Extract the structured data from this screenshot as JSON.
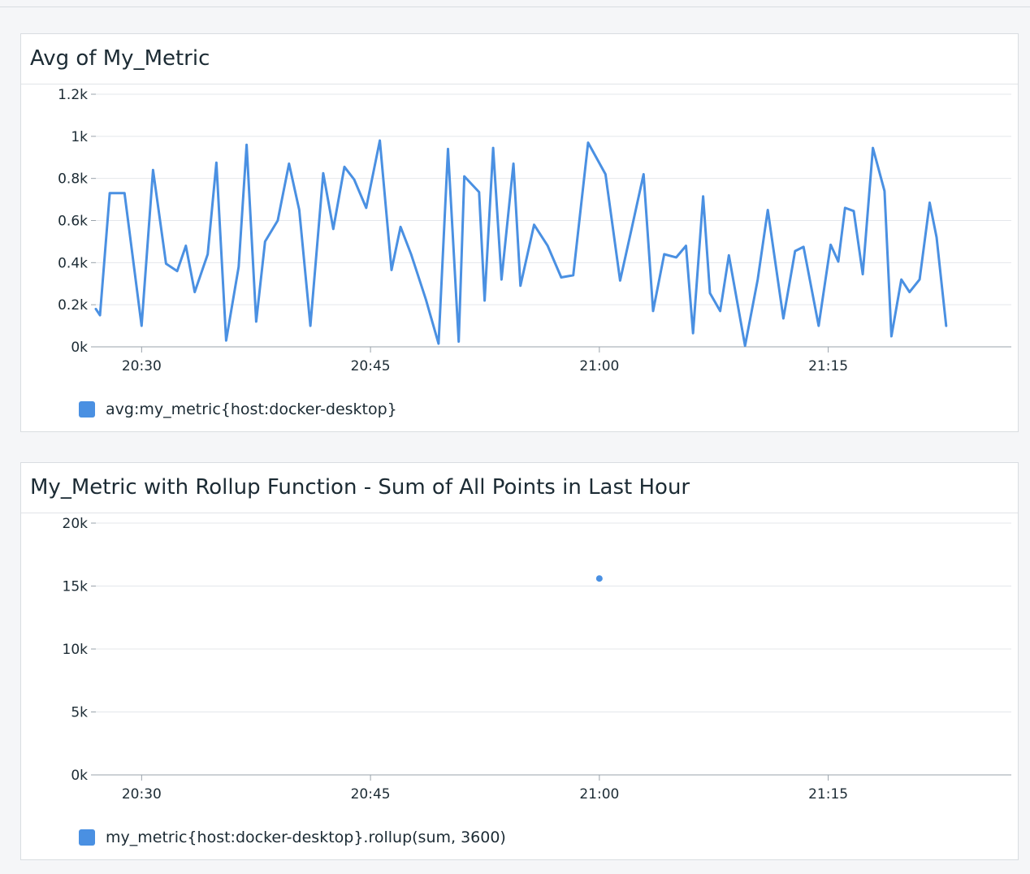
{
  "panels": [
    {
      "title": "Avg of My_Metric",
      "legend": "avg:my_metric{host:docker-desktop}",
      "color": "#4a90e2"
    },
    {
      "title": "My_Metric with Rollup Function - Sum of All Points in Last Hour",
      "legend": "my_metric{host:docker-desktop}.rollup(sum, 3600)",
      "color": "#4a90e2"
    }
  ],
  "chart_data": [
    {
      "type": "line",
      "title": "Avg of My_Metric",
      "xlabel": "",
      "ylabel": "",
      "x_ticks": [
        "20:30",
        "20:45",
        "21:00",
        "21:15"
      ],
      "x_tick_minutes": [
        30,
        45,
        60,
        75
      ],
      "xlim_minutes": [
        27,
        87
      ],
      "y_ticks": [
        "0k",
        "0.2k",
        "0.4k",
        "0.6k",
        "0.8k",
        "1k",
        "1.2k"
      ],
      "y_tick_values": [
        0,
        200,
        400,
        600,
        800,
        1000,
        1200
      ],
      "ylim": [
        0,
        1200
      ],
      "grid": true,
      "legend_position": "bottom-left",
      "series": [
        {
          "name": "avg:my_metric{host:docker-desktop}",
          "color": "#4a90e2",
          "x_minutes": [
            27.0,
            27.27,
            27.91,
            28.88,
            30.0,
            30.75,
            31.6,
            32.33,
            32.9,
            33.48,
            34.33,
            34.9,
            35.54,
            36.36,
            36.88,
            37.51,
            38.09,
            38.92,
            39.66,
            40.33,
            41.06,
            41.9,
            42.56,
            43.29,
            43.93,
            44.72,
            45.61,
            46.38,
            46.97,
            47.66,
            48.63,
            49.46,
            50.08,
            50.78,
            51.15,
            52.12,
            52.48,
            53.04,
            53.59,
            54.37,
            54.83,
            55.72,
            56.61,
            57.5,
            58.29,
            59.26,
            60.4,
            61.36,
            62.11,
            62.9,
            63.52,
            64.25,
            65.04,
            65.68,
            66.14,
            66.8,
            67.25,
            67.92,
            68.49,
            69.55,
            70.38,
            71.04,
            72.06,
            72.83,
            73.38,
            74.37,
            75.16,
            75.66,
            76.1,
            76.67,
            77.26,
            77.93,
            78.69,
            79.14,
            79.79,
            80.33,
            80.99,
            81.65,
            82.1,
            82.73,
            83.12,
            83.63,
            84.64,
            85.15
          ],
          "y": [
            180,
            150,
            730,
            730,
            100,
            840,
            395,
            360,
            480,
            260,
            440,
            875,
            30,
            380,
            960,
            120,
            500,
            600,
            870,
            650,
            100,
            825,
            560,
            855,
            795,
            660,
            980,
            365,
            570,
            440,
            225,
            15,
            940,
            25,
            810,
            735,
            220,
            945,
            320,
            870,
            290,
            580,
            480,
            330,
            340,
            970,
            820,
            315,
            560,
            820,
            170,
            440,
            425,
            480,
            65,
            715,
            255,
            170,
            435,
            5,
            320,
            650,
            135,
            455,
            475,
            100,
            485,
            405,
            660,
            645,
            345,
            945,
            740,
            50,
            320,
            260,
            320,
            685,
            520,
            100
          ]
        }
      ]
    },
    {
      "type": "scatter",
      "title": "My_Metric with Rollup Function - Sum of All Points in Last Hour",
      "xlabel": "",
      "ylabel": "",
      "x_ticks": [
        "20:30",
        "20:45",
        "21:00",
        "21:15"
      ],
      "x_tick_minutes": [
        30,
        45,
        60,
        75
      ],
      "xlim_minutes": [
        27,
        87
      ],
      "y_ticks": [
        "0k",
        "5k",
        "10k",
        "15k",
        "20k"
      ],
      "y_tick_values": [
        0,
        5000,
        10000,
        15000,
        20000
      ],
      "ylim": [
        0,
        20000
      ],
      "grid": true,
      "legend_position": "bottom-left",
      "series": [
        {
          "name": "my_metric{host:docker-desktop}.rollup(sum, 3600)",
          "color": "#4a90e2",
          "x_minutes": [
            60
          ],
          "y": [
            15600
          ]
        }
      ]
    }
  ]
}
